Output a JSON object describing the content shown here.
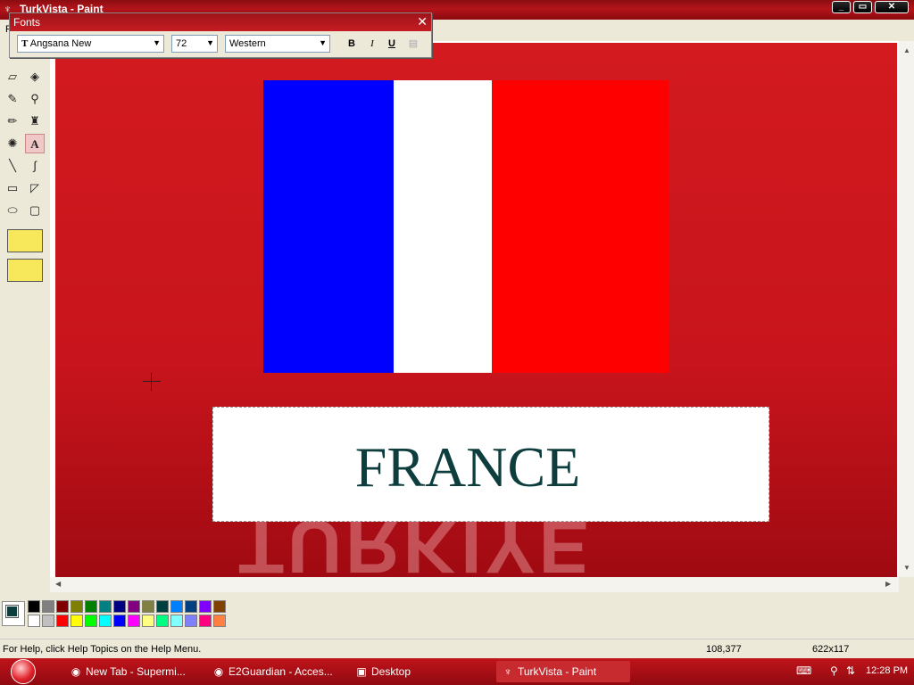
{
  "window": {
    "title": "TurkVista - Paint",
    "minimize": "_",
    "maximize": "▭",
    "close": "✕"
  },
  "menu": {
    "file": "F"
  },
  "fonts_toolbar": {
    "title": "Fonts",
    "font_name": "Angsana New",
    "font_size": "72",
    "script": "Western",
    "bold": "B",
    "italic": "I",
    "underline": "U"
  },
  "canvas": {
    "text": "FRANCE",
    "reflection_text": "TURKIYE",
    "flag_colors": {
      "left": "#0000ff",
      "middle": "#ffffff",
      "right": "#ff0000"
    }
  },
  "palette": {
    "row1": [
      "#000000",
      "#808080",
      "#800000",
      "#808000",
      "#008000",
      "#008080",
      "#000080",
      "#800080",
      "#808040",
      "#004040",
      "#0080ff",
      "#004080",
      "#8000ff",
      "#804000"
    ],
    "row2": [
      "#ffffff",
      "#c0c0c0",
      "#ff0000",
      "#ffff00",
      "#00ff00",
      "#00ffff",
      "#0000ff",
      "#ff00ff",
      "#ffff80",
      "#00ff80",
      "#80ffff",
      "#8080ff",
      "#ff0080",
      "#ff8040"
    ],
    "foreground": "#0d3d3d",
    "background": "#ffffff"
  },
  "status": {
    "help": "For Help, click Help Topics on the Help Menu.",
    "coords": "108,377",
    "size": "622x117"
  },
  "taskbar": {
    "items": [
      {
        "label": "New Tab - Supermi...",
        "icon": "browser-icon"
      },
      {
        "label": "E2Guardian - Acces...",
        "icon": "browser-icon"
      },
      {
        "label": "Desktop",
        "icon": "desktop-icon"
      },
      {
        "label": "TurkVista - Paint",
        "icon": "paint-icon"
      }
    ],
    "clock": "12:28 PM"
  }
}
